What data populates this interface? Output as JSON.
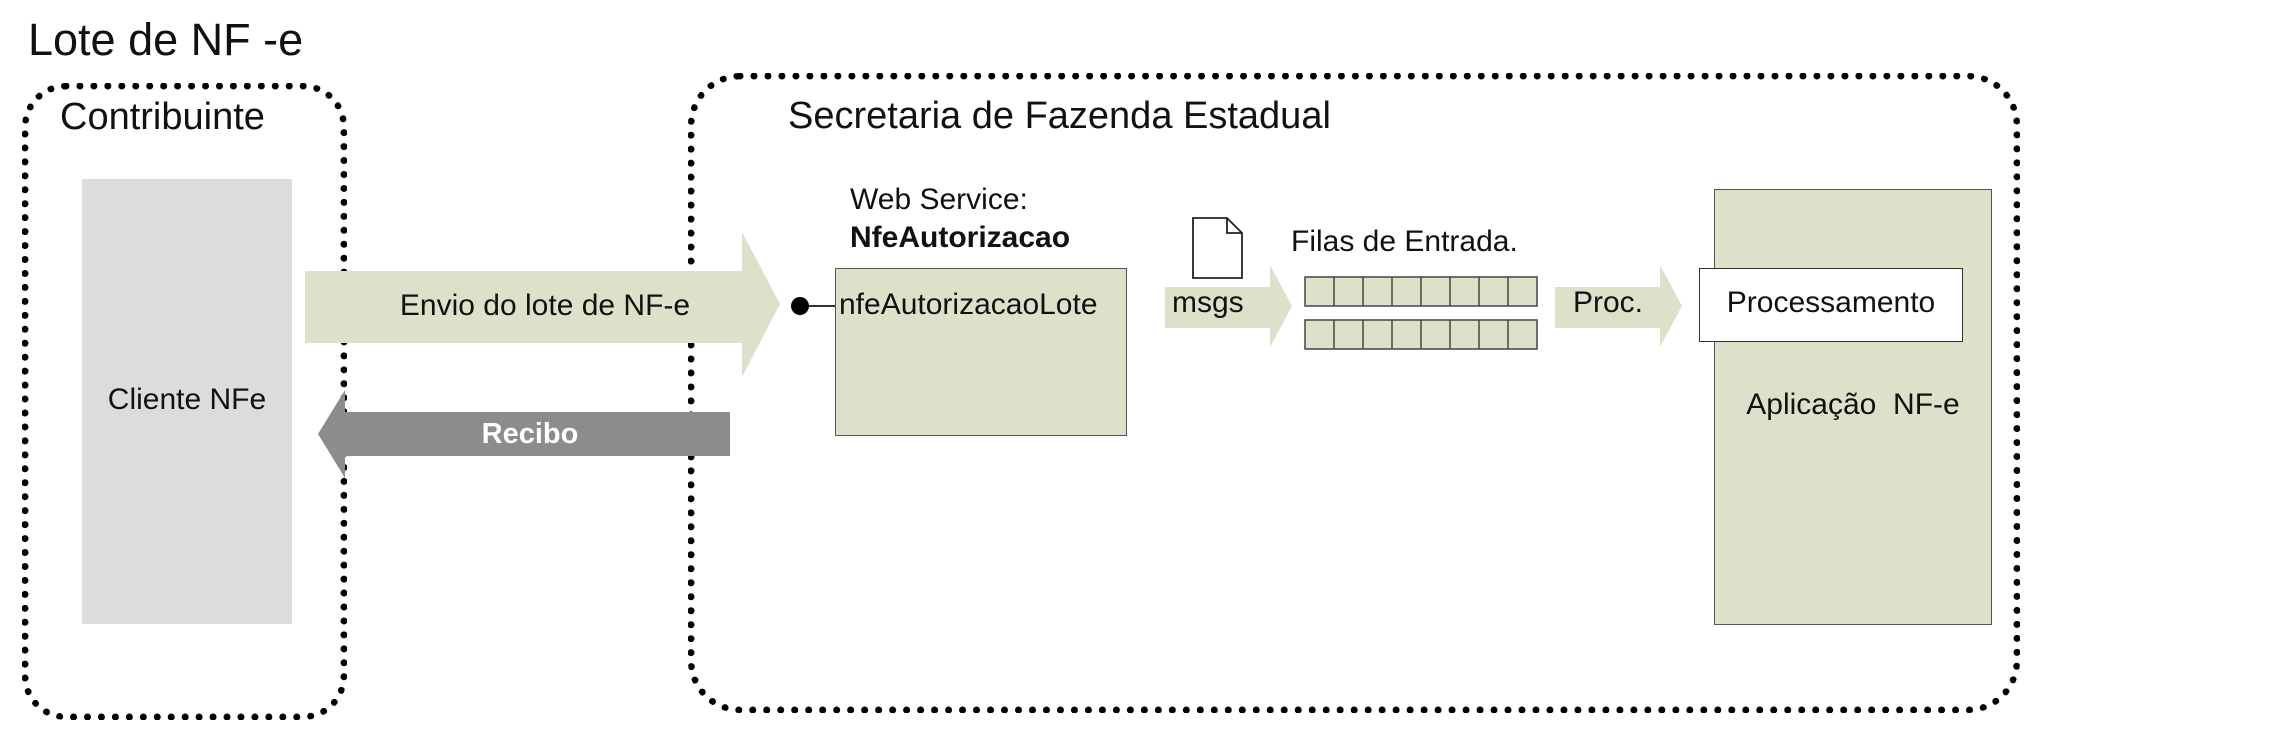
{
  "title": "Lote de NF -e",
  "contribuinte": {
    "label": "Contribuinte",
    "client_label": "Cliente NFe"
  },
  "sefaz": {
    "label": "Secretaria de Fazenda Estadual",
    "web_service_caption": "Web Service:",
    "web_service_name": "NfeAutorizacao",
    "web_service_operation": "nfeAutorizacaoLote",
    "msgs_label": "msgs",
    "filas_label": "Filas de Entrada.",
    "proc_label": "Proc.",
    "processamento_label": "Processamento",
    "app_label": "Aplicação  NF-e"
  },
  "arrows": {
    "send_label": "Envio do lote de NF-e",
    "recibo_label": "Recibo"
  },
  "colors": {
    "arrow_green": "#dde1c9",
    "arrow_gray": "#8c8c8c",
    "client_gray": "#dcdcdc"
  },
  "icons": {
    "document": "document-icon",
    "queue": "queue-icon",
    "connector": "lollipop-connector-icon"
  }
}
